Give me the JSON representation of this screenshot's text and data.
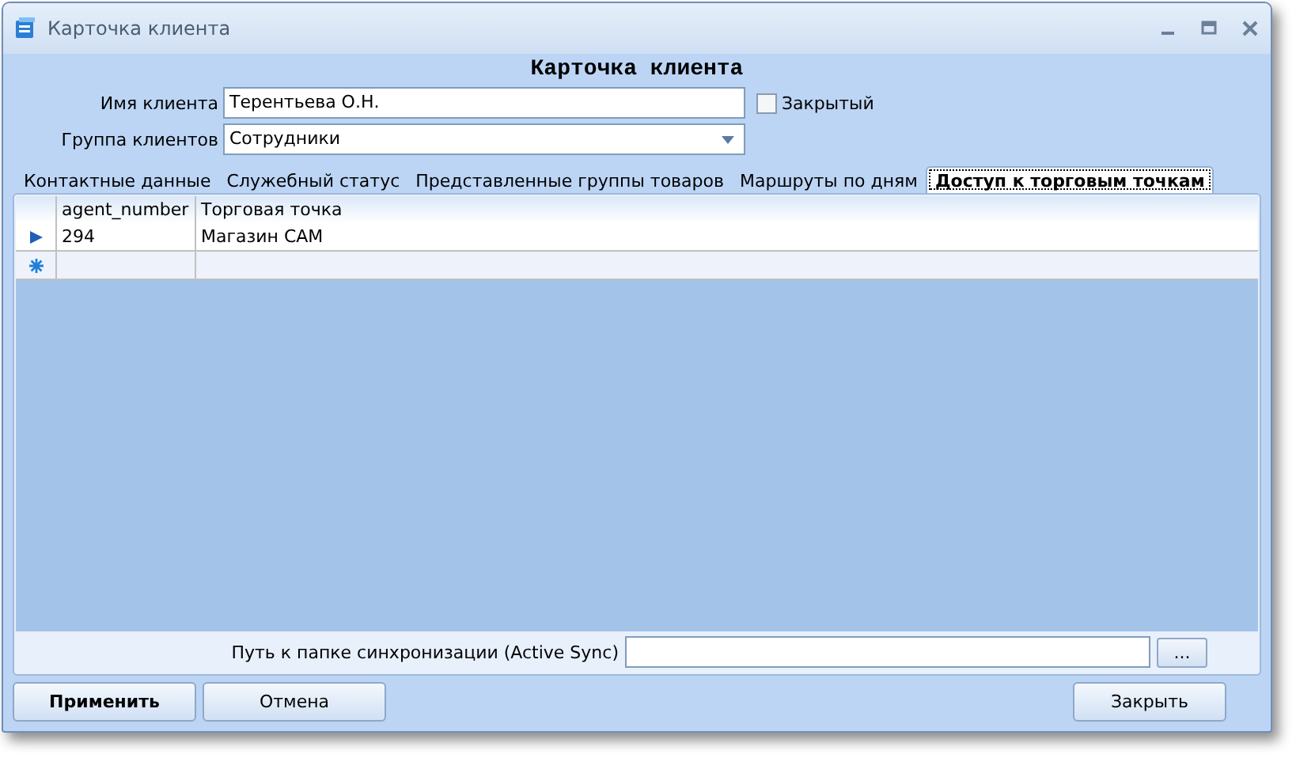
{
  "window": {
    "title": "Карточка клиента"
  },
  "heading": "Карточка клиента",
  "fields": {
    "name_label": "Имя клиента",
    "name_value": "Терентьева О.Н.",
    "closed_label": "Закрытый",
    "closed_checked": false,
    "group_label": "Группа клиентов",
    "group_value": "Сотрудники"
  },
  "tabs": [
    {
      "label": "Контактные данные",
      "selected": false
    },
    {
      "label": "Служебный статус",
      "selected": false
    },
    {
      "label": "Представленные группы товаров",
      "selected": false
    },
    {
      "label": "Маршруты по дням",
      "selected": false
    },
    {
      "label": "Доступ к торговым точкам",
      "selected": true
    }
  ],
  "table": {
    "columns": [
      "agent_number",
      "Торговая точка"
    ],
    "rows": [
      {
        "kind": "current",
        "cells": [
          "294",
          "Магазин САМ"
        ]
      },
      {
        "kind": "new",
        "cells": []
      }
    ]
  },
  "sync": {
    "label": "Путь к папке синхронизации (Active Sync)",
    "browse": "..."
  },
  "buttons": [
    {
      "label": "Применить",
      "default": true
    },
    {
      "label": "Отмена",
      "default": false
    }
  ],
  "close_button": "Закрыть"
}
